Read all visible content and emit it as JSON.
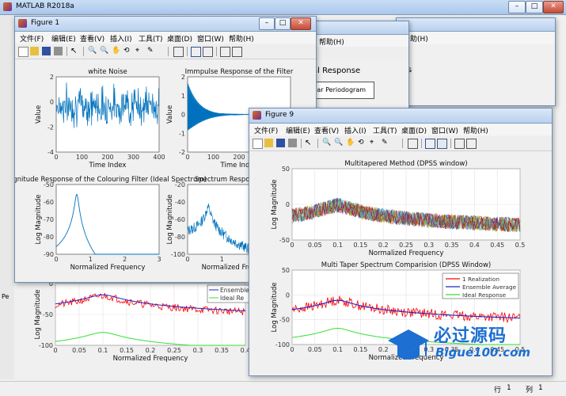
{
  "app": {
    "title": "MATLAB R2018a"
  },
  "figure1": {
    "title": "Figure 1",
    "menus": [
      "文件(F)",
      "编辑(E)",
      "查看(V)",
      "插入(I)",
      "工具(T)",
      "桌面(D)",
      "窗口(W)",
      "帮助(H)"
    ],
    "plots": {
      "white_noise": {
        "title": "white Noise",
        "xlabel": "Time Index",
        "ylabel": "Value",
        "xticks": [
          "0",
          "100",
          "200",
          "300",
          "400"
        ],
        "yticks": [
          "2",
          "0",
          "-2",
          "-4"
        ],
        "xlim": [
          0,
          500
        ],
        "ylim": [
          -4,
          2.5
        ]
      },
      "impulse": {
        "title": "Immpulse Response of the Filter",
        "xlabel": "Time Index",
        "ylabel": "Value",
        "xticks": [
          "0",
          "100",
          "200",
          "300",
          "400"
        ],
        "yticks": [
          "2",
          "1",
          "0",
          "-1",
          "-2"
        ],
        "xlim": [
          0,
          500
        ],
        "ylim": [
          -2,
          2
        ]
      },
      "colouring": {
        "title": "agnitude Response of the Colouring Filter (Ideal Spectrum)",
        "xlabel": "Normalized Frequency",
        "ylabel": "Log Magnitude",
        "xticks": [
          "0",
          "1",
          "2",
          "3"
        ],
        "yticks": [
          "-50",
          "-60",
          "-70",
          "-80",
          "-90"
        ],
        "xlim": [
          0,
          3
        ],
        "ylim": [
          -92,
          -45
        ]
      },
      "spectrum_resp": {
        "title": "Spectrum Response of the",
        "xlabel": "Normalized Frequency",
        "ylabel": "Log Magnitude",
        "xticks": [
          "0",
          "1",
          "2",
          "3"
        ],
        "yticks": [
          "-20",
          "-40",
          "-60",
          "-80",
          "-100"
        ],
        "xlim": [
          0,
          3
        ],
        "ylim": [
          -105,
          -15
        ]
      }
    }
  },
  "bg_windows": {
    "window_a": {
      "menu_help": "帮助(H)",
      "title_fragment": "al Response",
      "legend_fragment": "gular Periodogram"
    },
    "window_b": {
      "menu_help": "帮助(H)",
      "title_fragment": "s"
    },
    "lower_plot": {
      "xlabel": "Normalized Frequency",
      "ylabel": "Log Magnitude",
      "xticks": [
        "0",
        "0.05",
        "0.1",
        "0.15",
        "0.2",
        "0.25",
        "0.3",
        "0.35",
        "0.4"
      ],
      "yticks": [
        "0",
        "-50",
        "-100"
      ],
      "legend": [
        "Ensemble",
        "Ideal Re"
      ]
    }
  },
  "figure9": {
    "title": "Figure 9",
    "menus": [
      "文件(F)",
      "编辑(E)",
      "查看(V)",
      "插入(I)",
      "工具(T)",
      "桌面(D)",
      "窗口(W)",
      "帮助(H)"
    ],
    "plots": {
      "multitaper": {
        "title": "Multitapered Method (DPSS window)",
        "xlabel": "Normalized Frequency",
        "ylabel": "Log Magnitude",
        "xticks": [
          "0",
          "0.05",
          "0.1",
          "0.15",
          "0.2",
          "0.25",
          "0.3",
          "0.35",
          "0.4",
          "0.45",
          "0.5"
        ],
        "yticks": [
          "50",
          "0",
          "-50"
        ],
        "xlim": [
          0,
          0.5
        ],
        "ylim": [
          -80,
          65
        ]
      },
      "comparison": {
        "title": "Multi Taper Spectrum Comparision (DPSS Window)",
        "xlabel": "Normalized Frequency",
        "ylabel": "Log Magnitude",
        "xticks": [
          "0",
          "0.05",
          "0.1",
          "0.15",
          "0.2",
          "0.25",
          "0.3",
          "0.35",
          "0.4",
          "0.45",
          "0.5"
        ],
        "yticks": [
          "50",
          "0",
          "-50",
          "-100"
        ],
        "xlim": [
          0,
          0.5
        ],
        "ylim": [
          -100,
          65
        ],
        "legend": [
          "1 Realization",
          "Ensemble Average",
          "Ideal Response"
        ]
      }
    }
  },
  "statusbar": {
    "row_label": "行",
    "row_value": "1",
    "col_label": "列",
    "col_value": "1",
    "left_label": "Pe"
  },
  "watermark": {
    "text": "必过源码",
    "subtext": "Bigue100.com"
  },
  "colors": {
    "line_blue": "#0072bd",
    "red": "#ff0000",
    "green": "#33e033",
    "navy": "#2020c8"
  }
}
